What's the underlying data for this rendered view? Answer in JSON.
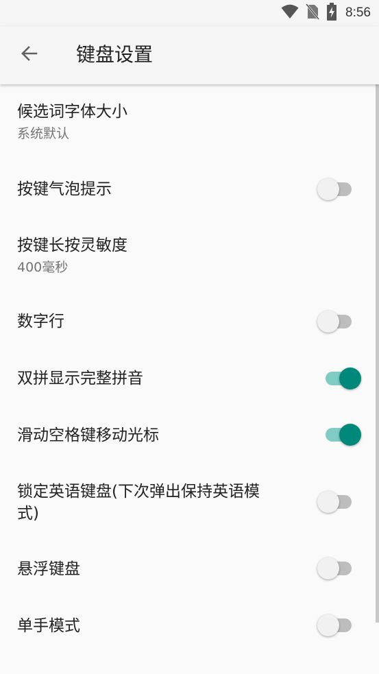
{
  "status_bar": {
    "time": "8:56",
    "icons": [
      "wifi-icon",
      "no-sim-icon",
      "battery-charging-icon"
    ]
  },
  "app_bar": {
    "back_icon": "arrow-left-icon",
    "title": "键盘设置"
  },
  "settings": [
    {
      "title": "候选词字体大小",
      "summary": "系统默认",
      "type": "text"
    },
    {
      "title": "按键气泡提示",
      "type": "switch",
      "checked": false
    },
    {
      "title": "按键长按灵敏度",
      "summary": "400毫秒",
      "type": "text"
    },
    {
      "title": "数字行",
      "type": "switch",
      "checked": false
    },
    {
      "title": "双拼显示完整拼音",
      "type": "switch",
      "checked": true
    },
    {
      "title": "滑动空格键移动光标",
      "type": "switch",
      "checked": true
    },
    {
      "title": "锁定英语键盘(下次弹出保持英语模式)",
      "type": "switch",
      "checked": false
    },
    {
      "title": "悬浮键盘",
      "type": "switch",
      "checked": false
    },
    {
      "title": "单手模式",
      "type": "switch",
      "checked": false
    }
  ],
  "colors": {
    "accent": "#00897b",
    "accent_track": "#80cbc4",
    "switch_off_track": "#bdbdbd",
    "switch_off_thumb": "#f1f1f1",
    "background": "#fafafa",
    "app_bar": "#f5f5f5"
  }
}
